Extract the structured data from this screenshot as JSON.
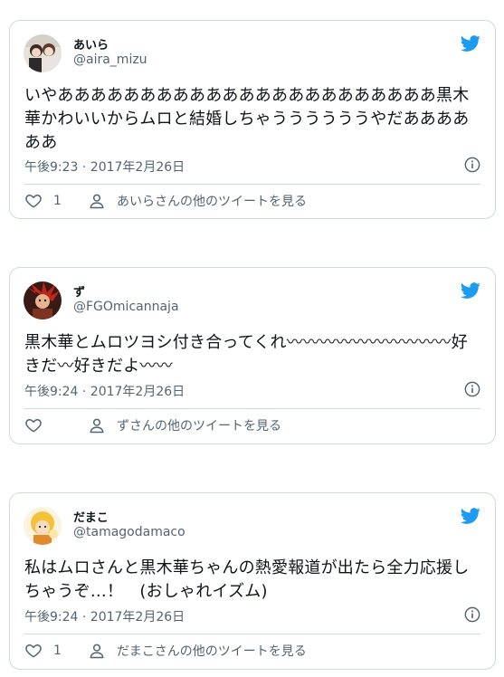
{
  "tweets": [
    {
      "name": "あいら",
      "handle": "@aira_mizu",
      "text": "いやあああああああああああああああああああああああ黒木華かわいいからムロと結婚しちゃううううううやだああああああ",
      "time": "午後9:23 · 2017年2月26日",
      "likes": "1",
      "other": "あいらさんの他のツイートを見る"
    },
    {
      "name": "ず",
      "handle": "@FGOmicannaja",
      "text": "黒木華とムロツヨシ付き合ってくれ〰〰〰〰〰〰〰〰〰〰好きだ〰好きだよ〰〰",
      "time": "午後9:24 · 2017年2月26日",
      "likes": "",
      "other": "ずさんの他のツイートを見る"
    },
    {
      "name": "だまこ",
      "handle": "@tamagodamaco",
      "text": "私はムロさんと黒木華ちゃんの熱愛報道が出たら全力応援しちゃうぞ…！　(おしゃれイズム)",
      "time": "午後9:24 · 2017年2月26日",
      "likes": "1",
      "other": "だまこさんの他のツイートを見る"
    }
  ],
  "colors": {
    "brand": "#1d9bf0",
    "muted": "#536471",
    "border": "#cfd9de"
  },
  "icons": {
    "platform": "twitter-bird-icon",
    "like": "heart-icon",
    "profile": "person-icon",
    "info": "info-icon"
  }
}
